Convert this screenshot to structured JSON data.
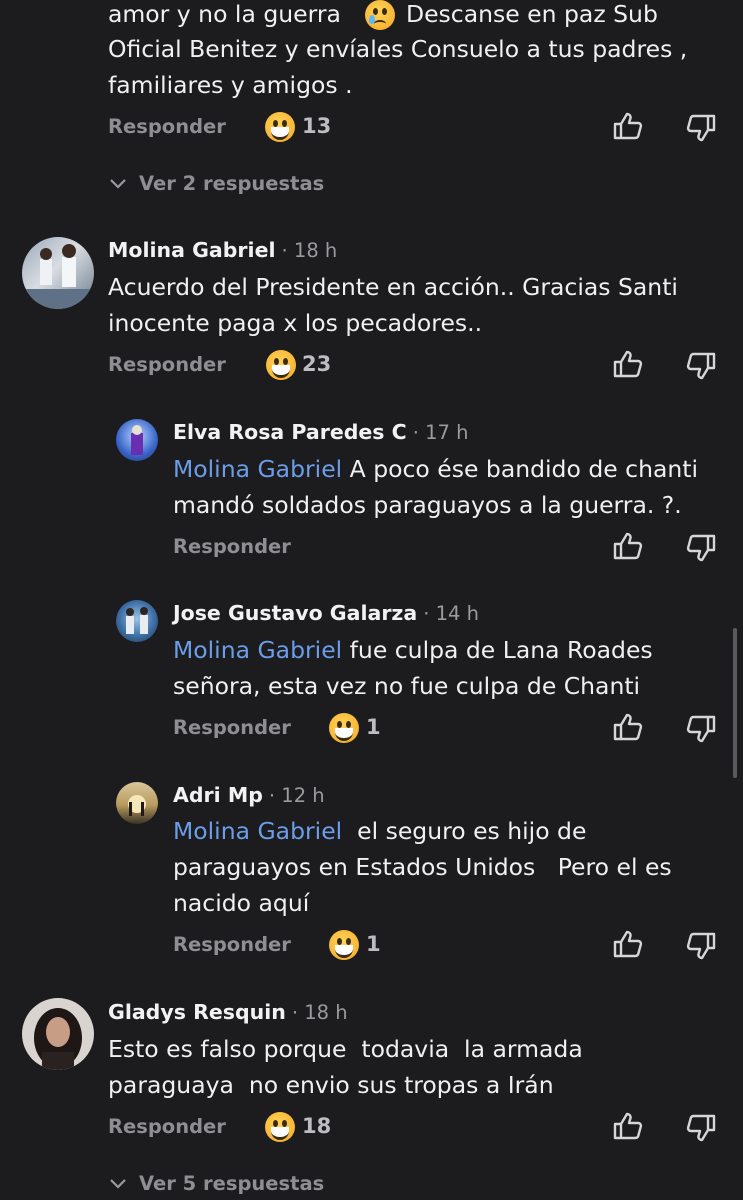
{
  "colors": {
    "background": "#1c1c1e",
    "mention": "#6b9de8",
    "muted": "#8e8e93"
  },
  "top_comment": {
    "lines": [
      "amor y no la guerra",
      "Descanse en paz Sub",
      "Oficial Benitez y envíales Consuelo a tus padres ,",
      "familiares y amigos ."
    ],
    "emoji_inline": "crying-face",
    "reply_label": "Responder",
    "reactions": "13",
    "view_replies": "Ver 2 respuestas"
  },
  "comments": [
    {
      "name": "Molina Gabriel",
      "time": "· 18 h",
      "lines": [
        "Acuerdo del Presidente en acción.. Gracias Santi",
        "inocente paga x los pecadores.."
      ],
      "reply_label": "Responder",
      "reactions": "23"
    },
    {
      "name": "Elva Rosa Paredes C",
      "time": "· 17 h",
      "mention": "Molina Gabriel",
      "lines": [
        " A poco ése bandido de chanti",
        "mandó soldados paraguayos a la guerra. ?."
      ],
      "reply_label": "Responder"
    },
    {
      "name": "Jose Gustavo Galarza",
      "time": "· 14 h",
      "mention": "Molina Gabriel",
      "lines": [
        " fue culpa de Lana Roades",
        "señora, esta vez no fue culpa de Chanti"
      ],
      "reply_label": "Responder",
      "reactions": "1"
    },
    {
      "name": "Adri Mp",
      "time": "· 12 h",
      "mention": "Molina Gabriel",
      "lines": [
        "  el seguro es hijo de",
        "paraguayos en Estados Unidos   Pero el es",
        "nacido aquí"
      ],
      "reply_label": "Responder",
      "reactions": "1"
    },
    {
      "name": "Gladys Resquin",
      "time": "· 18 h",
      "lines": [
        "Esto es falso porque  todavia  la armada",
        "paraguaya  no envio sus tropas a Irán"
      ],
      "reply_label": "Responder",
      "reactions": "18",
      "view_replies": "Ver 5 respuestas"
    }
  ],
  "icons": [
    "like-icon",
    "dislike-icon",
    "chevron-down-icon",
    "laughing-emoji-icon"
  ]
}
